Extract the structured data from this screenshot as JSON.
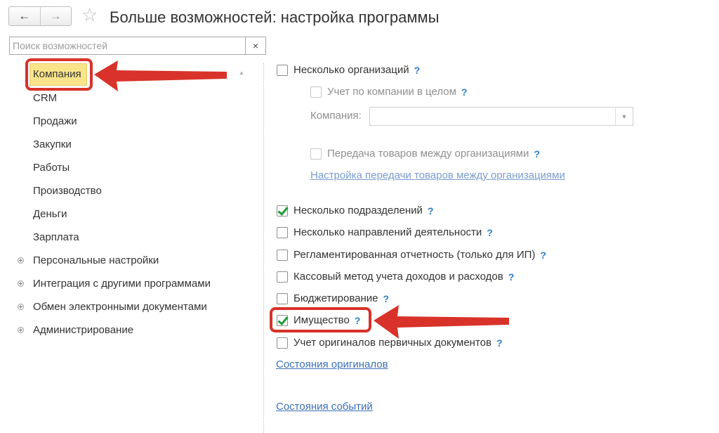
{
  "header": {
    "back_icon": "←",
    "forward_icon": "→",
    "star_icon": "☆",
    "title": "Больше возможностей: настройка программы"
  },
  "search": {
    "placeholder": "Поиск возможностей",
    "value": "",
    "clear_icon": "×"
  },
  "sidebar": {
    "items": [
      {
        "label": "Компания",
        "selected": true
      },
      {
        "label": "CRM"
      },
      {
        "label": "Продажи"
      },
      {
        "label": "Закупки"
      },
      {
        "label": "Работы"
      },
      {
        "label": "Производство"
      },
      {
        "label": "Деньги"
      },
      {
        "label": "Зарплата"
      }
    ],
    "groups": [
      {
        "label": "Персональные настройки"
      },
      {
        "label": "Интеграция с другими программами"
      },
      {
        "label": "Обмен электронными документами"
      },
      {
        "label": "Администрирование"
      }
    ],
    "scroll_up_icon": "▲"
  },
  "settings": {
    "help": "?",
    "multiple_orgs": {
      "label": "Несколько организаций",
      "checked": false
    },
    "company_accounting": {
      "label": "Учет по компании в целом",
      "checked": false
    },
    "company_field": {
      "label": "Компания:",
      "value": "",
      "dropdown_icon": "▼"
    },
    "goods_transfer": {
      "label": "Передача товаров между организациями",
      "checked": false
    },
    "transfer_link": "Настройка передачи товаров между организациями",
    "multiple_departments": {
      "label": "Несколько подразделений",
      "checked": true
    },
    "multiple_activities": {
      "label": "Несколько направлений деятельности",
      "checked": false
    },
    "regulated_reporting": {
      "label": "Регламентированная отчетность (только для ИП)",
      "checked": false
    },
    "cash_method": {
      "label": "Кассовый метод учета доходов и расходов",
      "checked": false
    },
    "budgeting": {
      "label": "Бюджетирование",
      "checked": false
    },
    "property": {
      "label": "Имущество",
      "checked": true
    },
    "originals_accounting": {
      "label": "Учет оригиналов первичных документов",
      "checked": false
    },
    "originals_link": "Состояния оригиналов",
    "events_link": "Состояния событий"
  },
  "colors": {
    "annotation_red": "#d8322a",
    "highlight": "#fae48a",
    "link": "#3b70b7",
    "check": "#1f9a35"
  }
}
